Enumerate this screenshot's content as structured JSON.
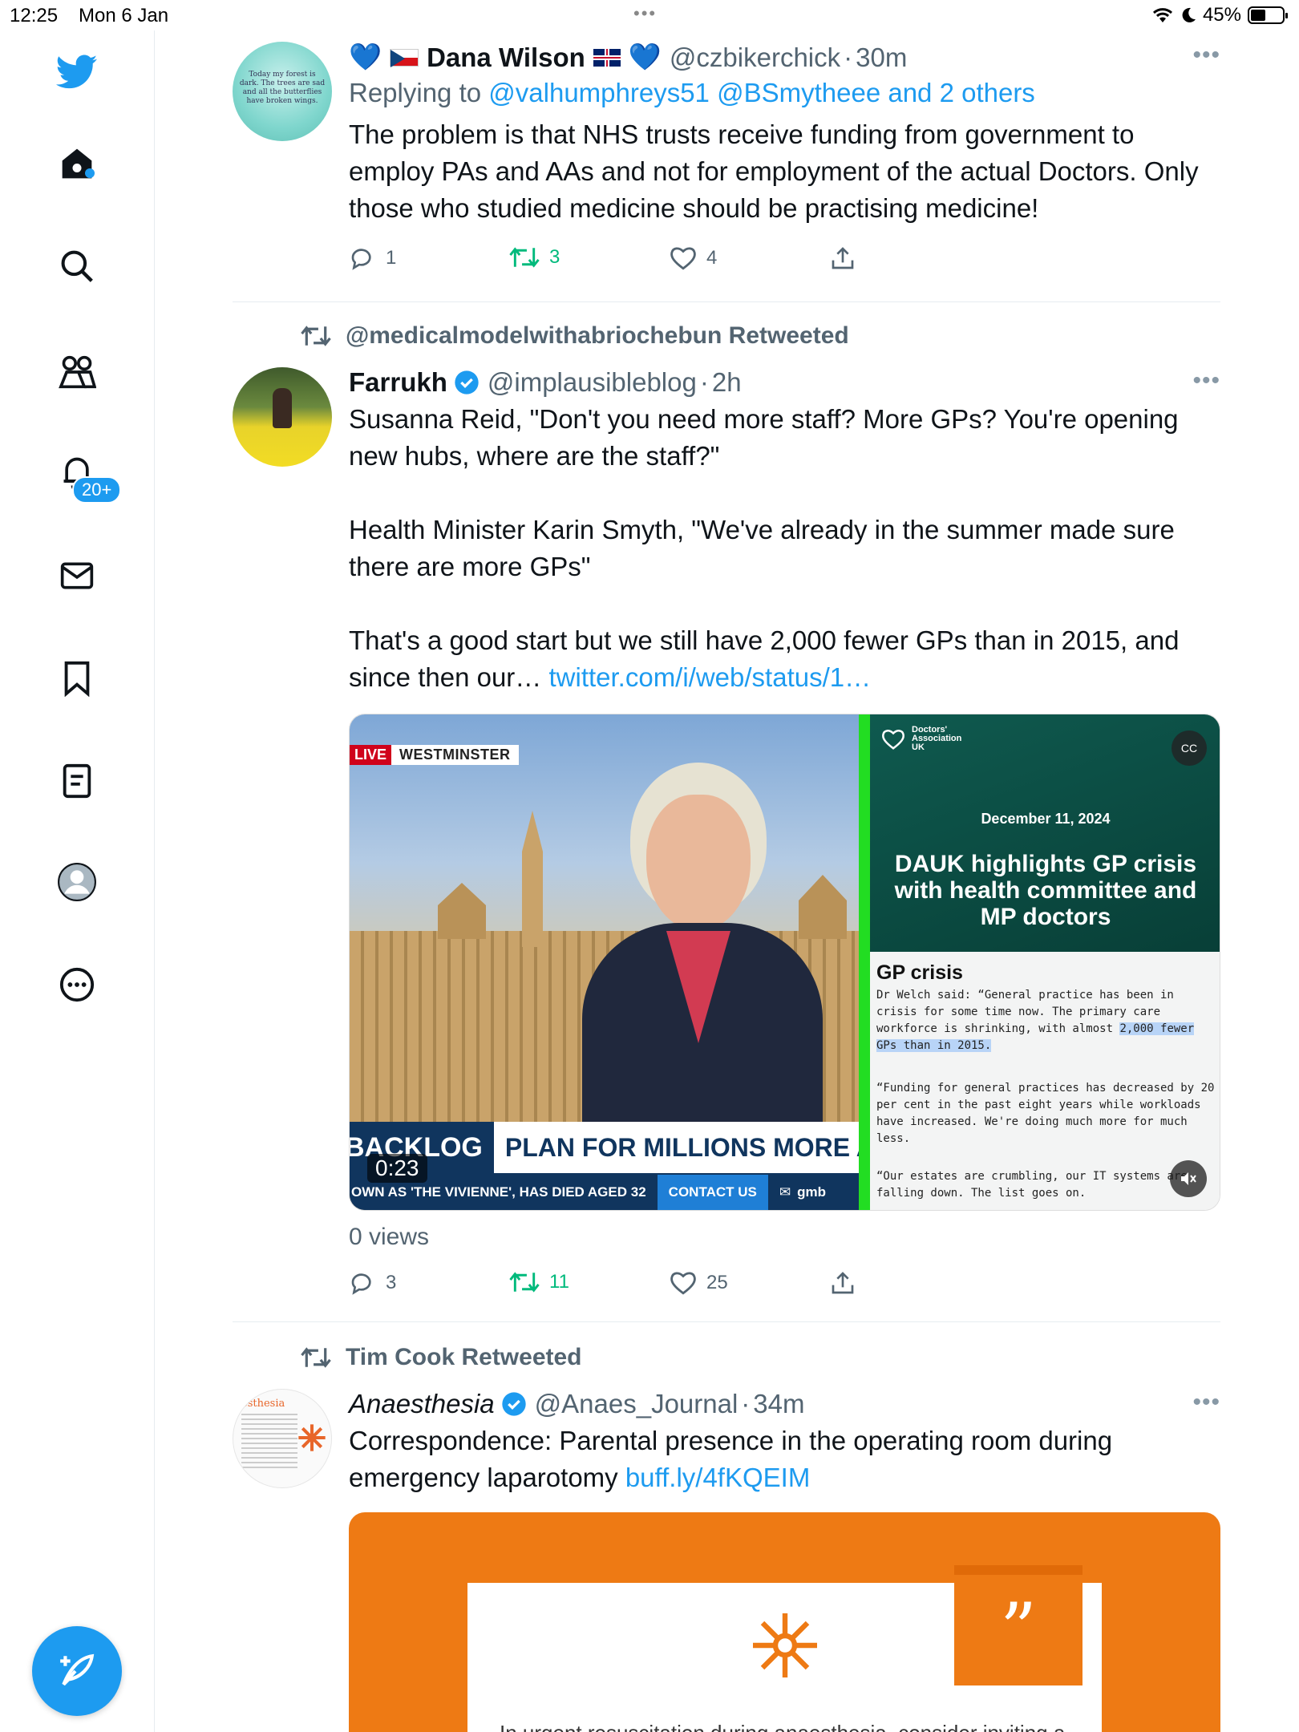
{
  "status": {
    "time": "12:25",
    "date": "Mon 6 Jan",
    "battery": "45%",
    "battery_level": 0.45
  },
  "sidebar": {
    "notifications_badge": "20+"
  },
  "tweets": [
    {
      "author": "Dana Wilson",
      "handle": "@czbikerchick",
      "time": "30m",
      "replying_label": "Replying to",
      "replying_to": "@valhumphreys51 @BSmytheee and 2 others",
      "text": "The problem is that NHS trusts receive funding from government to employ PAs and AAs and not for employment of the actual Doctors. Only those who studied medicine should be practising medicine!",
      "avatar_text": "Today my forest is dark. The trees are sad and all the butterflies have broken wings.",
      "replies": "1",
      "retweets": "3",
      "likes": "4"
    },
    {
      "retweeted_by": "@medicalmodelwithabriochebun Retweeted",
      "author": "Farrukh",
      "handle": "@implausibleblog",
      "time": "2h",
      "text_p1": "Susanna Reid, \"Don't you need more staff? More GPs? You're opening new hubs, where are the staff?\"",
      "text_p2": "Health Minister Karin Smyth, \"We've already in the summer made sure there are more GPs\"",
      "text_p3": "That's a good start but we still have 2,000 fewer GPs than in 2015, and since then our…",
      "link": "twitter.com/i/web/status/1…",
      "video": {
        "live": "LIVE",
        "location": "WESTMINSTER",
        "ticker_left": "BACKLOG",
        "ticker_right": "PLAN FOR MILLIONS MORE APPOI",
        "crawl": "OWN AS 'THE VIVIENNE', HAS DIED AGED 32",
        "contact": "CONTACT US",
        "gmb": "gmb",
        "duration": "0:23",
        "dauk_org": "Doctors' Association UK",
        "dauk_date": "December 11, 2024",
        "dauk_title": "DAUK highlights GP crisis with health committee and MP doctors",
        "dauk_heading": "GP crisis",
        "dauk_p1a": "Dr Welch said: “General practice has been in crisis for some time now. The primary care workforce is shrinking, with almost ",
        "dauk_p1b": "2,000 fewer GPs than in 2015.",
        "dauk_p2": "“Funding for general practices has decreased by 20 per cent in the past eight years while workloads have increased. We're doing much more for much less.",
        "dauk_p3": "“Our estates are crumbling, our IT systems are falling down. The list goes on."
      },
      "views": "0 views",
      "replies": "3",
      "retweets": "11",
      "likes": "25"
    },
    {
      "retweeted_by": "Tim Cook Retweeted",
      "author": "Anaesthesia",
      "handle": "@Anaes_Journal",
      "time": "34m",
      "text": "Correspondence: Parental presence in the operating room during emergency laparotomy ",
      "link": "buff.ly/4fKQEIM",
      "card_text": "In urgent resuscitation during anaesthesia, consider inviting a"
    }
  ],
  "colors": {
    "brand": "#1d9bf0",
    "retweet": "#00ba7c",
    "card_orange": "#ee7a14"
  }
}
